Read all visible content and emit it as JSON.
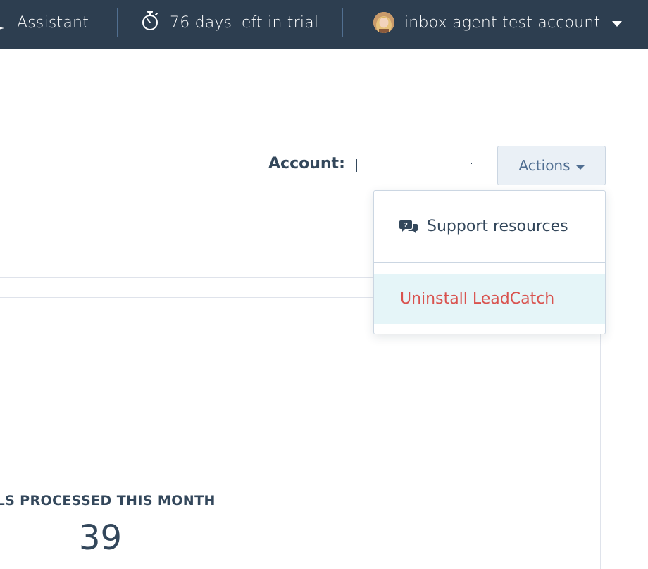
{
  "topbar": {
    "assistant_label": "Assistant",
    "trial_label": "76 days left in trial",
    "account_name": "inbox agent test account",
    "icons": {
      "assistant": "sparkle-icon",
      "trial": "stopwatch-icon",
      "account_menu": "caret-down-icon"
    }
  },
  "account": {
    "label": "Account:",
    "value": ""
  },
  "actions": {
    "label": "Actions",
    "menu": {
      "support_label": "Support resources",
      "support_icon": "support-chat-icon",
      "uninstall_label": "Uninstall LeadCatch"
    }
  },
  "stats": {
    "emails_label": "AILS PROCESSED THIS MONTH",
    "emails_value": "39"
  },
  "colors": {
    "topbar_bg": "#2d3e50",
    "text": "#33475b",
    "danger": "#d9534f",
    "highlight_bg": "#e5f5f8",
    "button_bg": "#eaf0f6"
  }
}
